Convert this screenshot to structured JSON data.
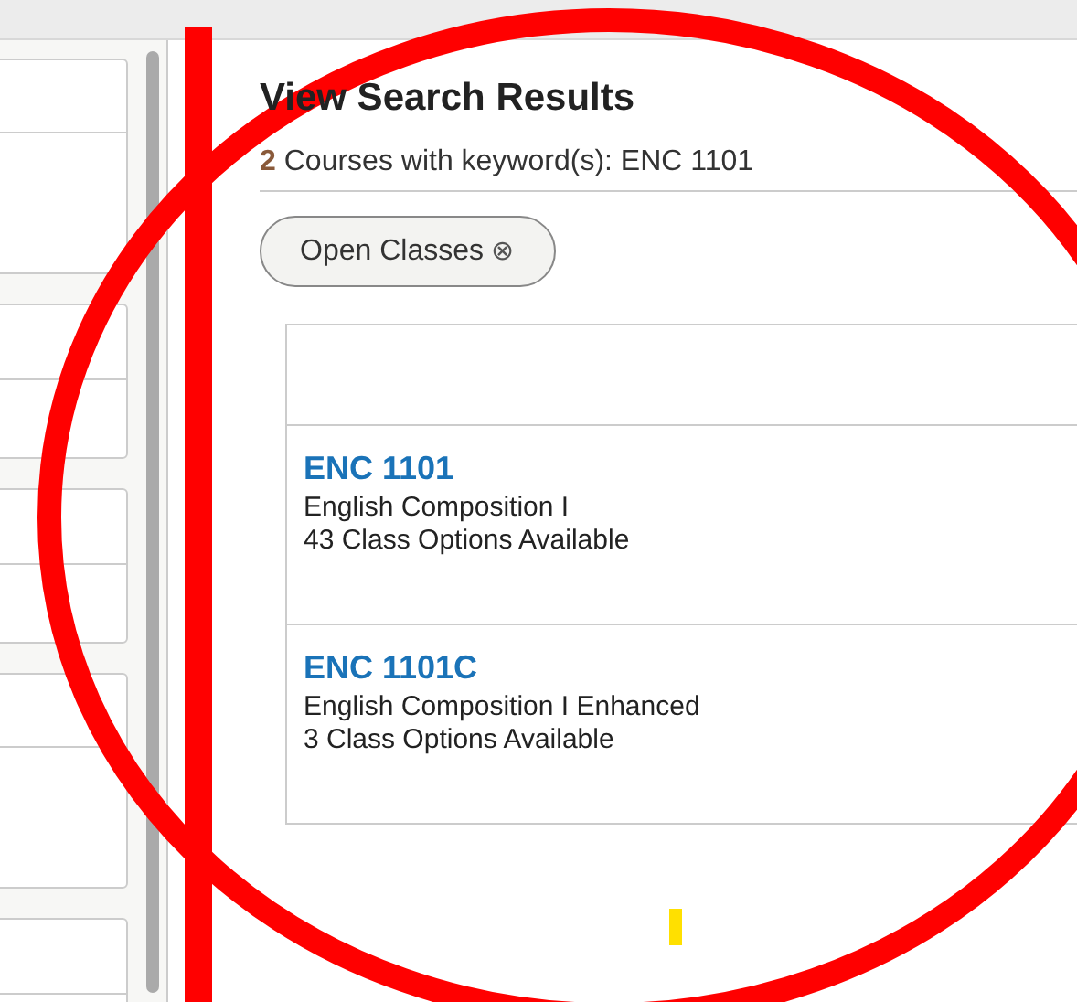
{
  "sidebar": {
    "cards": [
      {
        "kind": "tall"
      },
      {
        "kind": "short"
      },
      {
        "kind": "short"
      },
      {
        "kind": "tall"
      },
      {
        "kind": "short"
      }
    ]
  },
  "results": {
    "title": "View Search Results",
    "count": "2",
    "summary": "Courses with keyword(s): ENC 1101",
    "filters": [
      {
        "label": "Open Classes",
        "icon": "⊗"
      }
    ],
    "courses": [
      {
        "code": "ENC 1101",
        "name": "English Composition I",
        "options": "43 Class Options Available"
      },
      {
        "code": "ENC 1101C",
        "name": "English Composition I Enhanced",
        "options": "3 Class Options Available"
      }
    ]
  },
  "annotations": [
    {
      "kind": "circle",
      "color": "#ff0000"
    },
    {
      "kind": "line",
      "color": "#ff0000"
    },
    {
      "kind": "marker",
      "color": "#ffe000"
    }
  ]
}
